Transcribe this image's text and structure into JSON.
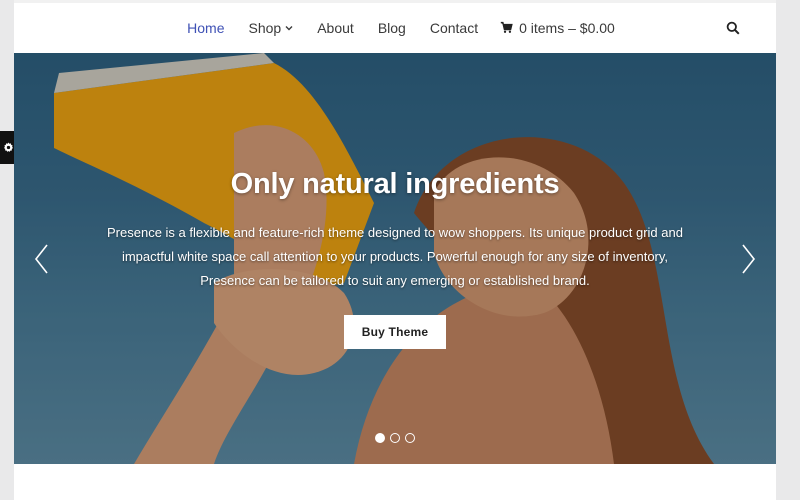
{
  "nav": {
    "items": [
      {
        "label": "Home",
        "active": true
      },
      {
        "label": "Shop",
        "has_dropdown": true
      },
      {
        "label": "About"
      },
      {
        "label": "Blog"
      },
      {
        "label": "Contact"
      }
    ],
    "cart_label": "0 items – $0.00",
    "search_icon": "search-icon",
    "accent_color": "#3f51b5"
  },
  "hero": {
    "title": "Only natural ingredients",
    "description": "Presence is a flexible and feature-rich theme designed to wow shoppers. Its unique product grid and impactful white space call attention to your products. Powerful enough for any size of inventory, Presence can be tailored to suit any emerging or established brand.",
    "button_label": "Buy Theme",
    "slides_total": 3,
    "active_slide": 1
  },
  "settings_tab": {
    "icon": "gear-icon"
  }
}
